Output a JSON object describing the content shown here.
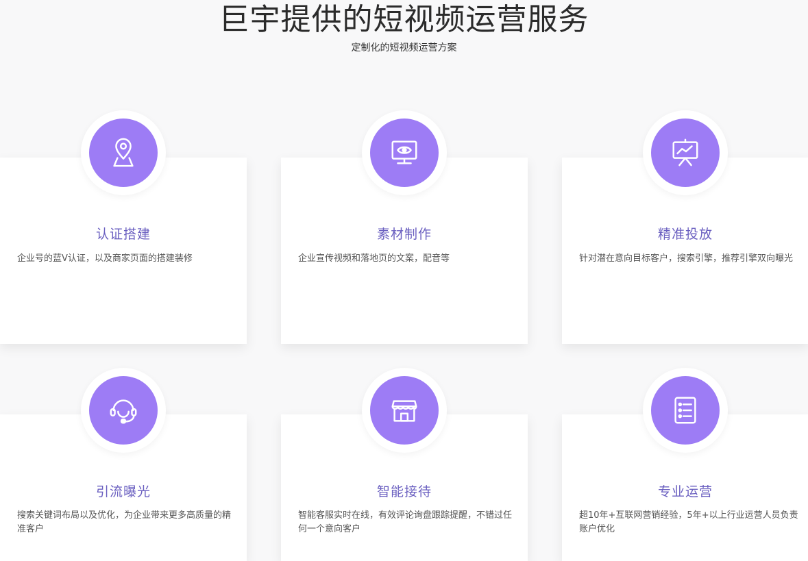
{
  "header": {
    "title": "巨宇提供的短视频运营服务",
    "subtitle": "定制化的短视频运营方案"
  },
  "colors": {
    "background": "#f8f8f9",
    "icon_circle": "#9d7cf5",
    "card_title": "#6a5fc0",
    "text": "#555555"
  },
  "services": [
    {
      "title": "认证搭建",
      "description": "企业号的蓝V认证，以及商家页面的搭建装修",
      "icon": "location-pin-icon"
    },
    {
      "title": "素材制作",
      "description": "企业宣传视频和落地页的文案，配音等",
      "icon": "monitor-eye-icon"
    },
    {
      "title": "精准投放",
      "description": "针对潜在意向目标客户，搜索引擎，推荐引擎双向曝光",
      "icon": "presentation-chart-icon"
    },
    {
      "title": "引流曝光",
      "description": "搜索关键词布局以及优化，为企业带来更多高质量的精准客户",
      "icon": "headset-icon"
    },
    {
      "title": "智能接待",
      "description": "智能客服实时在线，有效评论询盘跟踪提醒，不错过任何一个意向客户",
      "icon": "storefront-icon"
    },
    {
      "title": "专业运营",
      "description": "超10年+互联网营销经验，5年+以上行业运营人员负责账户优化",
      "icon": "checklist-icon"
    }
  ]
}
